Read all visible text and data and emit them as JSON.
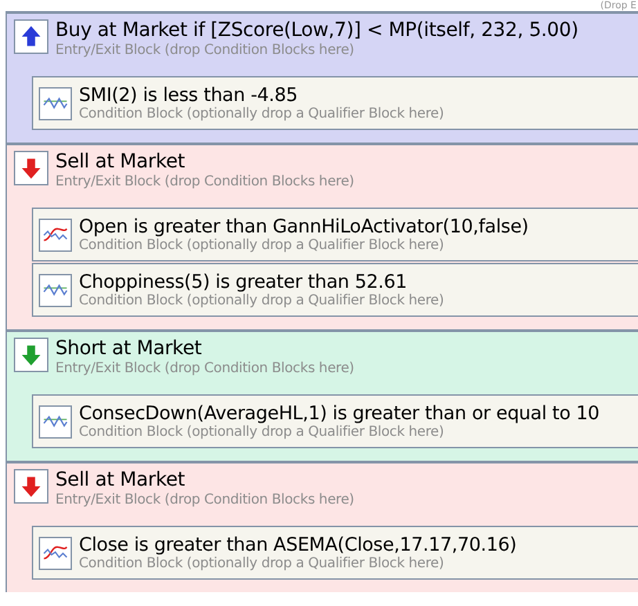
{
  "corner_hint": "(Drop E",
  "blocks": [
    {
      "kind": "buy",
      "title": "Buy at Market if [ZScore(Low,7)] < MP(itself, 232, 5.00)",
      "subtitle": "Entry/Exit Block (drop Condition Blocks here)",
      "conditions": [
        {
          "kind": "oscillator",
          "text": "SMI(2) is less than -4.85",
          "subtitle": "Condition Block (optionally drop a Qualifier Block here)"
        }
      ]
    },
    {
      "kind": "sell",
      "title": "Sell at Market",
      "subtitle": "Entry/Exit Block (drop Condition Blocks here)",
      "conditions": [
        {
          "kind": "crossover",
          "text": "Open is greater than GannHiLoActivator(10,false)",
          "subtitle": "Condition Block (optionally drop a Qualifier Block here)"
        },
        {
          "kind": "oscillator",
          "text": "Choppiness(5) is greater than 52.61",
          "subtitle": "Condition Block (optionally drop a Qualifier Block here)"
        }
      ]
    },
    {
      "kind": "short",
      "title": "Short at Market",
      "subtitle": "Entry/Exit Block (drop Condition Blocks here)",
      "conditions": [
        {
          "kind": "oscillator",
          "text": "ConsecDown(AverageHL,1) is greater than or equal to 10",
          "subtitle": "Condition Block (optionally drop a Qualifier Block here)"
        }
      ]
    },
    {
      "kind": "sell",
      "title": "Sell at Market",
      "subtitle": "Entry/Exit Block (drop Condition Blocks here)",
      "conditions": [
        {
          "kind": "crossover",
          "text": "Close is greater than ASEMA(Close,17.17,70.16)",
          "subtitle": "Condition Block (optionally drop a Qualifier Block here)"
        }
      ]
    }
  ]
}
